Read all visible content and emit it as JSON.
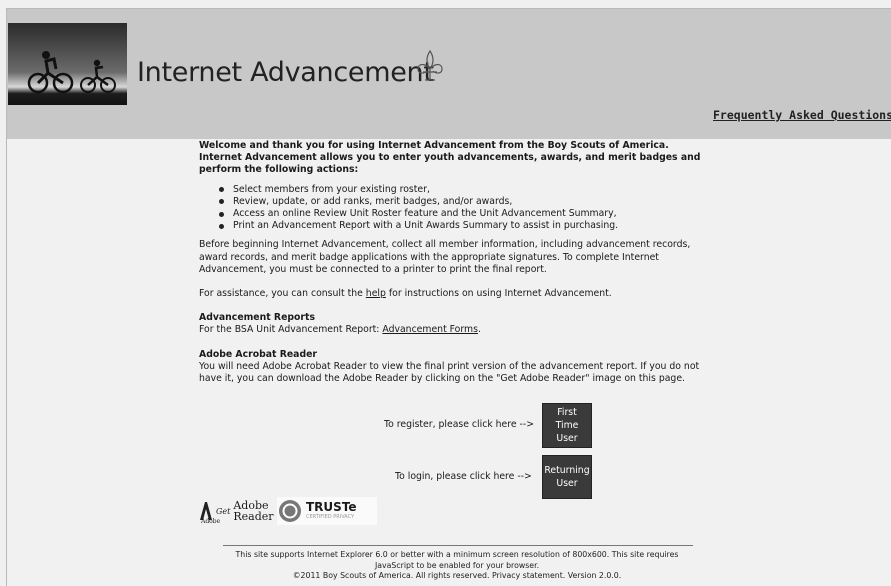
{
  "header": {
    "title": "Internet Advancement",
    "faq_link": "Frequently Asked Questions"
  },
  "intro": {
    "line1": "Welcome and thank you for using Internet Advancement from the Boy Scouts of America.",
    "line2": "Internet Advancement allows you to enter youth advancements, awards, and merit badges and perform the following actions:"
  },
  "bullets": [
    "Select members from your existing roster,",
    "Review, update, or add ranks, merit badges, and/or awards,",
    "Access an online Review Unit Roster feature and the Unit Advancement Summary,",
    "Print an Advancement Report with a Unit Awards Summary to assist in purchasing."
  ],
  "before_text": "Before beginning Internet Advancement, collect all member information, including advancement records, award records, and merit badge applications with the appropriate signatures.  To complete Internet Advancement, you must be connected to a printer to print the final report.",
  "assist": {
    "prefix": "For assistance, you can consult the ",
    "link": "help",
    "suffix": " for instructions on using Internet Advancement."
  },
  "reports": {
    "heading": "Advancement Reports",
    "prefix": "For the BSA Unit Advancement Report: ",
    "link": "Advancement Forms",
    "suffix": "."
  },
  "acrobat": {
    "heading": "Adobe Acrobat Reader",
    "text": "You will need Adobe Acrobat Reader to view the final print version of the advancement report. If you do not have it, you can download the Adobe Reader by clicking on the \"Get Adobe Reader\" image on this page."
  },
  "register": {
    "label": "To register, please click here -->",
    "button_lines": [
      "First",
      "Time",
      "User"
    ]
  },
  "login": {
    "label": "To login, please click here -->",
    "button_lines": [
      "Returning",
      "User"
    ]
  },
  "logos": {
    "adobe_get": "Get",
    "adobe_name": "Adobe",
    "adobe_reader": "Reader",
    "adobe_small": "Adobe",
    "truste": "TRUSTe",
    "truste_sub": "CERTIFIED PRIVACY"
  },
  "footer": {
    "line1": "This site supports Internet Explorer 6.0 or better with a minimum screen resolution of 800x600. This site requires",
    "line2": "JavaScript to be enabled for your browser.",
    "line3": "©2011 Boy Scouts of America. All rights reserved. Privacy statement. Version 2.0.0."
  }
}
